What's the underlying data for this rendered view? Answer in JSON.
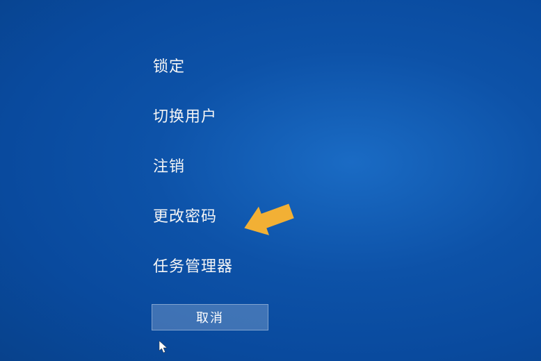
{
  "menu": {
    "items": [
      {
        "id": "lock",
        "label": "锁定"
      },
      {
        "id": "switch-user",
        "label": "切换用户"
      },
      {
        "id": "sign-out",
        "label": "注销"
      },
      {
        "id": "change-password",
        "label": "更改密码"
      },
      {
        "id": "task-manager",
        "label": "任务管理器"
      }
    ]
  },
  "cancel": {
    "label": "取消"
  },
  "annotation": {
    "arrow_color": "#f2b035"
  }
}
